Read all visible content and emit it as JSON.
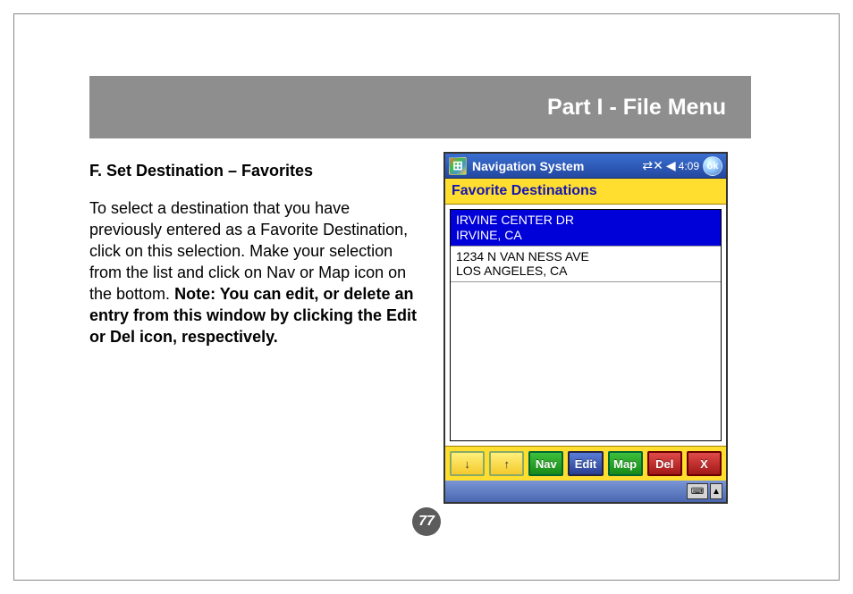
{
  "header": {
    "title": "Part I - File Menu"
  },
  "section": {
    "heading": "F. Set Destination – Favorites",
    "paragraph": "To select a destination that you have previously entered as a Favorite Destination, click on this selection. Make your selection from the list and click on Nav or Map icon on the bottom.",
    "note": "Note: You can edit, or delete an entry from this window by clicking the Edit or Del icon, respectively."
  },
  "page_number": "77",
  "device": {
    "wm_title": "Navigation System",
    "time": "4:09",
    "ok": "ok",
    "screen_label": "Favorite Destinations",
    "items": [
      {
        "line1": "IRVINE CENTER DR",
        "line2": "IRVINE, CA",
        "selected": true
      },
      {
        "line1": "1234 N VAN NESS AVE",
        "line2": "LOS ANGELES, CA",
        "selected": false
      }
    ],
    "toolbar": {
      "down": "↓",
      "up": "↑",
      "nav": "Nav",
      "edit": "Edit",
      "map": "Map",
      "del": "Del",
      "close": "X"
    },
    "kbd": "⌨",
    "popup_arrow": "▲"
  }
}
